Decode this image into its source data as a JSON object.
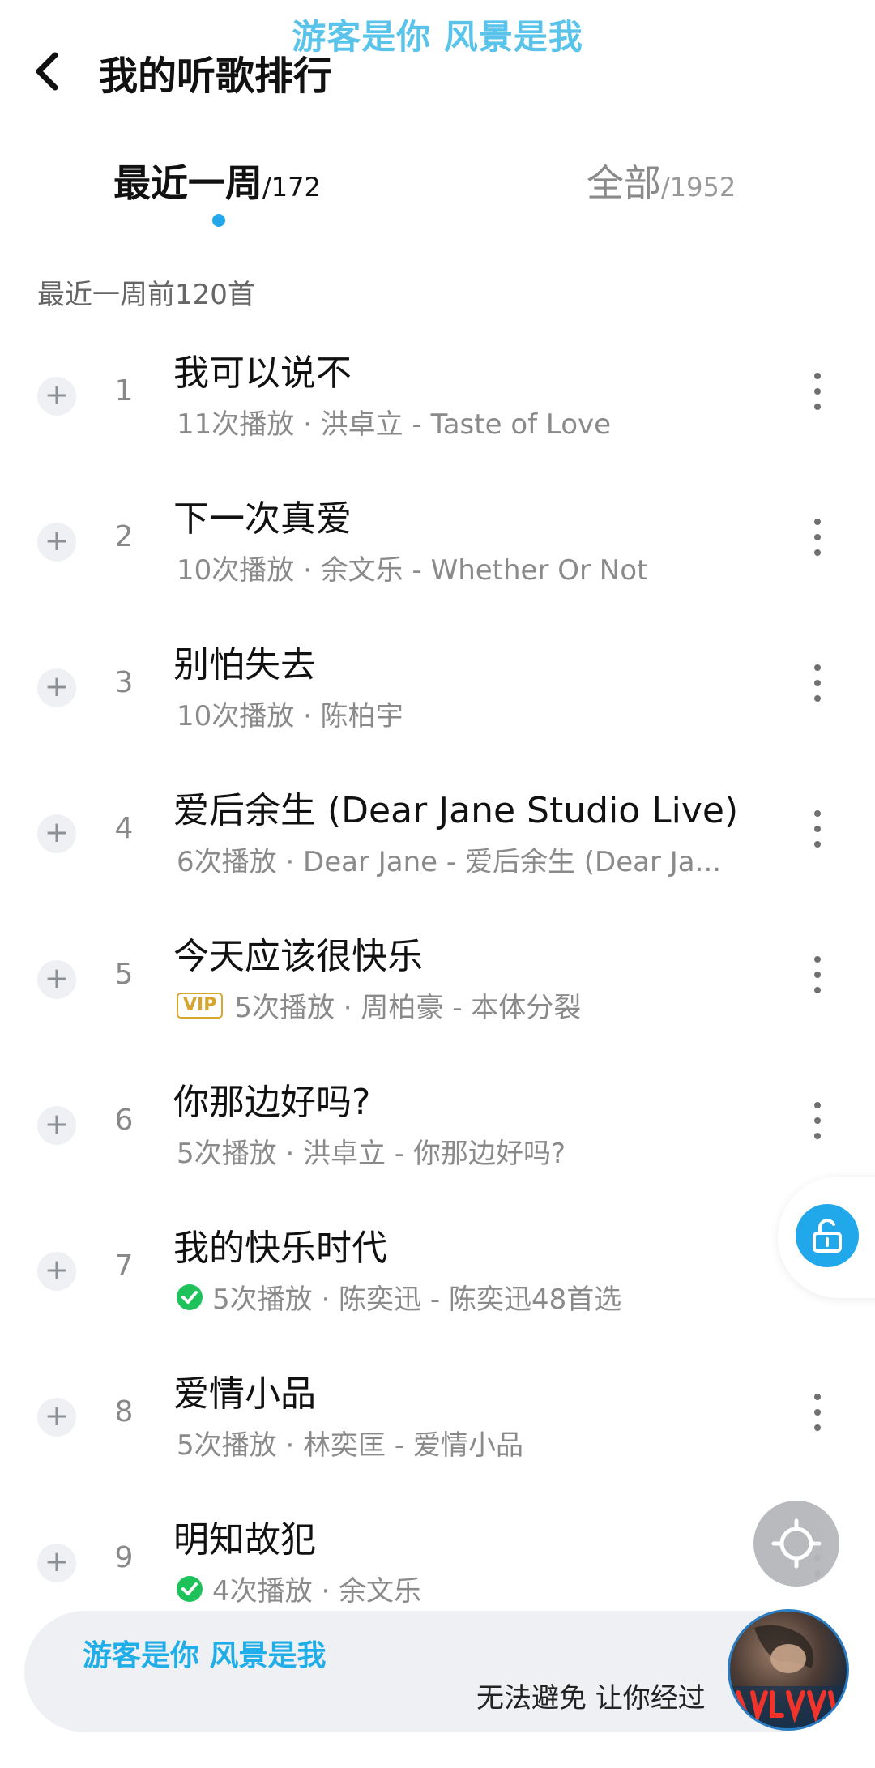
{
  "top_lyric": "游客是你 风景是我",
  "header": {
    "title": "我的听歌排行"
  },
  "tabs": [
    {
      "label": "最近一周",
      "count": "/172",
      "active": true
    },
    {
      "label": "全部",
      "count": "/1952",
      "active": false
    }
  ],
  "section_label": "最近一周前120首",
  "songs": [
    {
      "rank": "1",
      "title": "我可以说不",
      "meta": "11次播放 · 洪卓立 - Taste of Love",
      "badge": ""
    },
    {
      "rank": "2",
      "title": "下一次真爱",
      "meta": "10次播放 · 余文乐 - Whether Or Not",
      "badge": ""
    },
    {
      "rank": "3",
      "title": "别怕失去",
      "meta": "10次播放 · 陈柏宇",
      "badge": ""
    },
    {
      "rank": "4",
      "title": "爱后余生 (Dear Jane Studio Live)",
      "meta": "6次播放 · Dear Jane - 爱后余生 (Dear Ja...",
      "badge": ""
    },
    {
      "rank": "5",
      "title": "今天应该很快乐",
      "meta": "5次播放 · 周柏豪 - 本体分裂",
      "badge": "VIP"
    },
    {
      "rank": "6",
      "title": "你那边好吗?",
      "meta": "5次播放 · 洪卓立 - 你那边好吗?",
      "badge": ""
    },
    {
      "rank": "7",
      "title": "我的快乐时代",
      "meta": "5次播放 · 陈奕迅 - 陈奕迅48首选",
      "badge": "downloaded"
    },
    {
      "rank": "8",
      "title": "爱情小品",
      "meta": "5次播放 · 林奕匡 - 爱情小品",
      "badge": ""
    },
    {
      "rank": "9",
      "title": "明知故犯",
      "meta": "4次播放 · 余文乐",
      "badge": "downloaded"
    }
  ],
  "player": {
    "lyric_line_1": "游客是你 风景是我",
    "lyric_line_2": "无法避免 让你经过",
    "album_art_text": "DEAR JANE"
  },
  "icons": {
    "back": "chevron-left-icon",
    "add": "plus-icon",
    "more": "more-vertical-icon",
    "lock": "unlock-icon",
    "locate": "locate-icon",
    "vip": "vip-badge",
    "downloaded": "check-circle-icon"
  },
  "colors": {
    "accent": "#22a7e8",
    "lyric": "#59c3ea",
    "vip": "#d6a52c",
    "downloaded": "#1fc25a",
    "player_bg": "#eff0f3"
  }
}
